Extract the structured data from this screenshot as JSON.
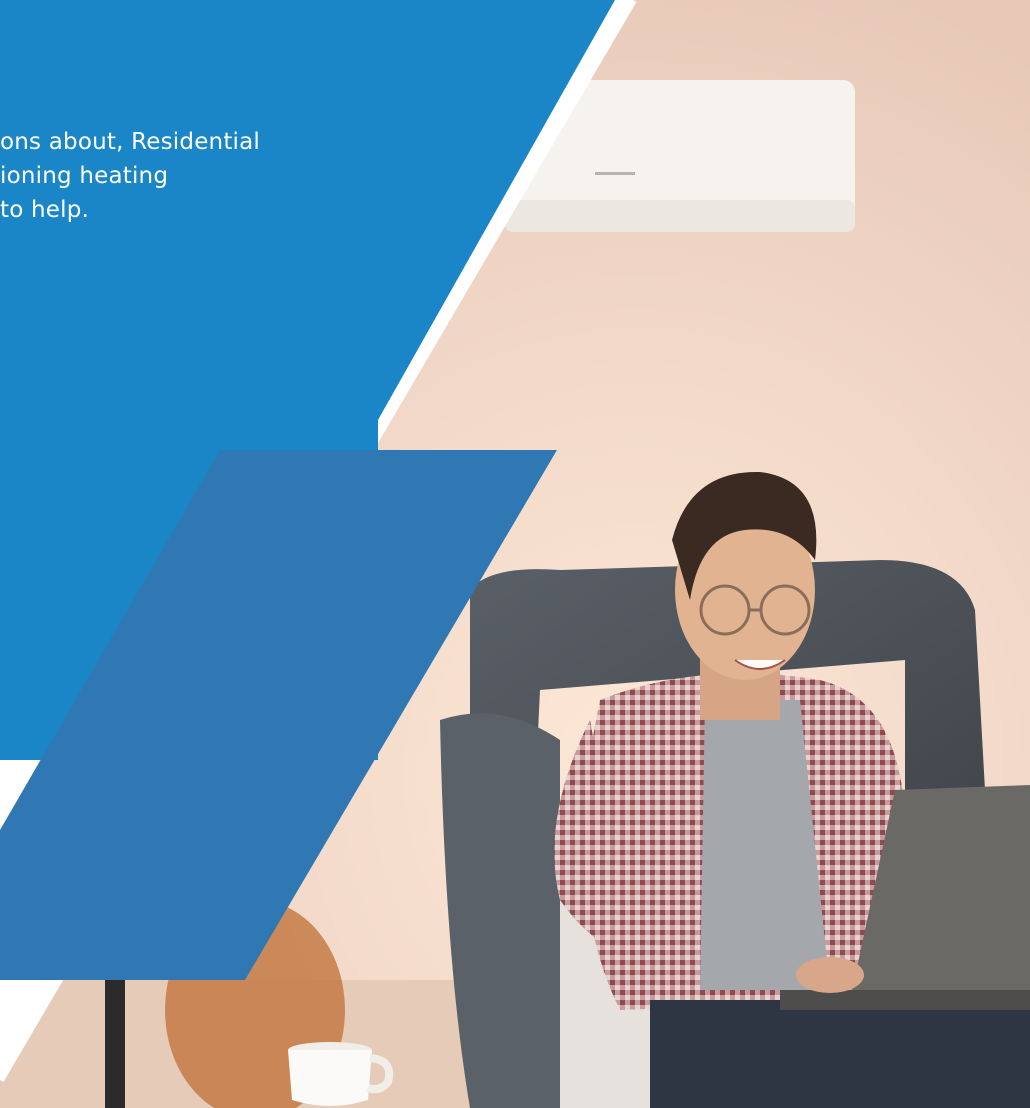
{
  "hero": {
    "lines": [
      "ons about, Residential",
      "ioning heating",
      "to help."
    ]
  },
  "colors": {
    "primary_blue": "#1a86c8",
    "secondary_blue": "#2f78b3",
    "wall_peach": "#f3dccd",
    "chair_gray": "#4d5258",
    "shirt_red": "#9b5a5e",
    "tshirt_gray": "#a4a8ad",
    "laptop_gray": "#6b6966",
    "ac_unit_white": "#f5f2ee"
  },
  "icons": {
    "air_conditioner": "air-conditioner-icon",
    "laptop": "laptop-icon",
    "coffee_cup": "coffee-cup-icon"
  }
}
